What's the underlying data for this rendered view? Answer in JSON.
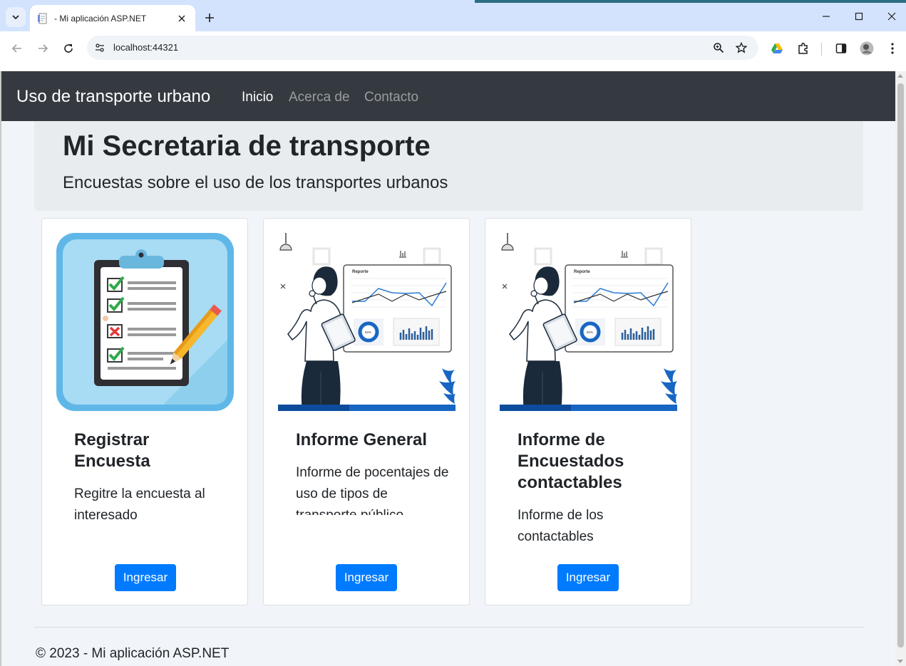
{
  "browser": {
    "tab_title": "- Mi aplicación ASP.NET",
    "url": "localhost:44321"
  },
  "navbar": {
    "brand": "Uso de transporte urbano",
    "links": [
      {
        "label": "Inicio",
        "active": true
      },
      {
        "label": "Acerca de",
        "active": false
      },
      {
        "label": "Contacto",
        "active": false
      }
    ]
  },
  "jumbotron": {
    "title": "Mi Secretaria de transporte",
    "lead": "Encuestas sobre el uso de los transportes urbanos"
  },
  "cards": [
    {
      "title": "Registrar Encuesta",
      "text": "Regitre la encuesta al interesado",
      "button": "Ingresar",
      "image": "clipboard-checklist"
    },
    {
      "title": "Informe General",
      "text": "Informe de pocentajes de uso de tipos de transporte público",
      "button": "Ingresar",
      "image": "report-dashboard"
    },
    {
      "title": "Informe de Encuestados contactables",
      "text": "Informe de los contactables",
      "button": "Ingresar",
      "image": "report-dashboard"
    }
  ],
  "report_illustration": {
    "panel_title": "Reporte",
    "donut_label": "60%"
  },
  "footer": {
    "text": "© 2023 - Mi aplicación ASP.NET"
  },
  "colors": {
    "navbar_bg": "#343a40",
    "primary": "#007bff",
    "jumbotron_bg": "#e9ecef",
    "chrome_tab_strip": "#d3e3fd"
  }
}
